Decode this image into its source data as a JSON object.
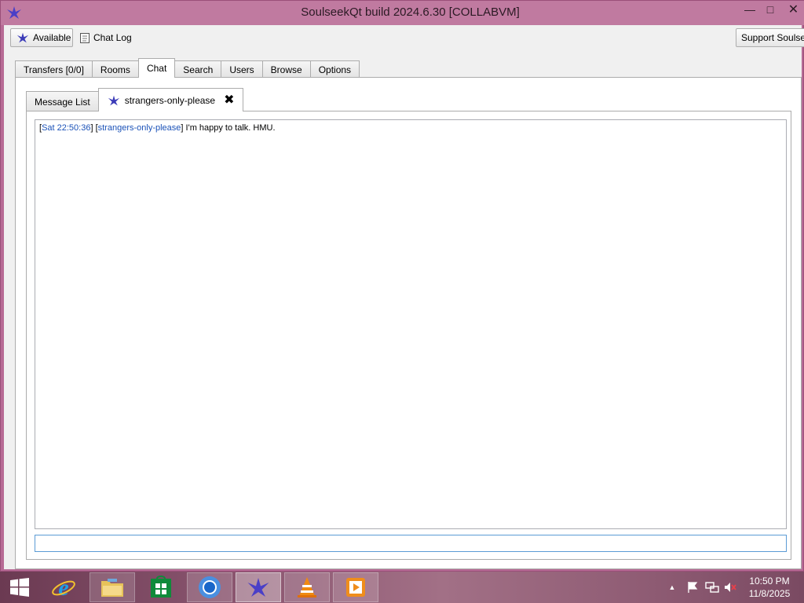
{
  "window": {
    "title": "SoulseekQt build 2024.6.30 [COLLABVM]",
    "minimize_glyph": "—",
    "maximize_glyph": "□",
    "close_glyph": "✕"
  },
  "toolbar": {
    "status_label": "Available",
    "chat_log_label": "Chat Log",
    "support_label": "Support Soulseek"
  },
  "main_tabs": [
    {
      "label": "Transfers [0/0]"
    },
    {
      "label": "Rooms"
    },
    {
      "label": "Chat",
      "active": true
    },
    {
      "label": "Search"
    },
    {
      "label": "Users"
    },
    {
      "label": "Browse"
    },
    {
      "label": "Options"
    }
  ],
  "chat": {
    "sub_tabs": [
      {
        "label": "Message List"
      },
      {
        "label": "strangers-only-please",
        "active": true,
        "close_glyph": "✖"
      }
    ],
    "messages": [
      {
        "time": "Sat 22:50:36",
        "user": "strangers-only-please",
        "text": "I'm happy to talk. HMU."
      }
    ],
    "input_value": ""
  },
  "taskbar": {
    "items": [
      {
        "name": "internet-explorer"
      },
      {
        "name": "file-explorer"
      },
      {
        "name": "windows-store"
      },
      {
        "name": "chrome"
      },
      {
        "name": "soulseek",
        "current": true
      },
      {
        "name": "vlc"
      },
      {
        "name": "media-player"
      }
    ],
    "tray_up_glyph": "▲",
    "clock_time": "10:50 PM",
    "clock_date": "11/8/2025"
  },
  "colors": {
    "window_frame": "#c07aa0",
    "link_blue": "#1b52b8",
    "input_focus": "#5b9bd5"
  }
}
